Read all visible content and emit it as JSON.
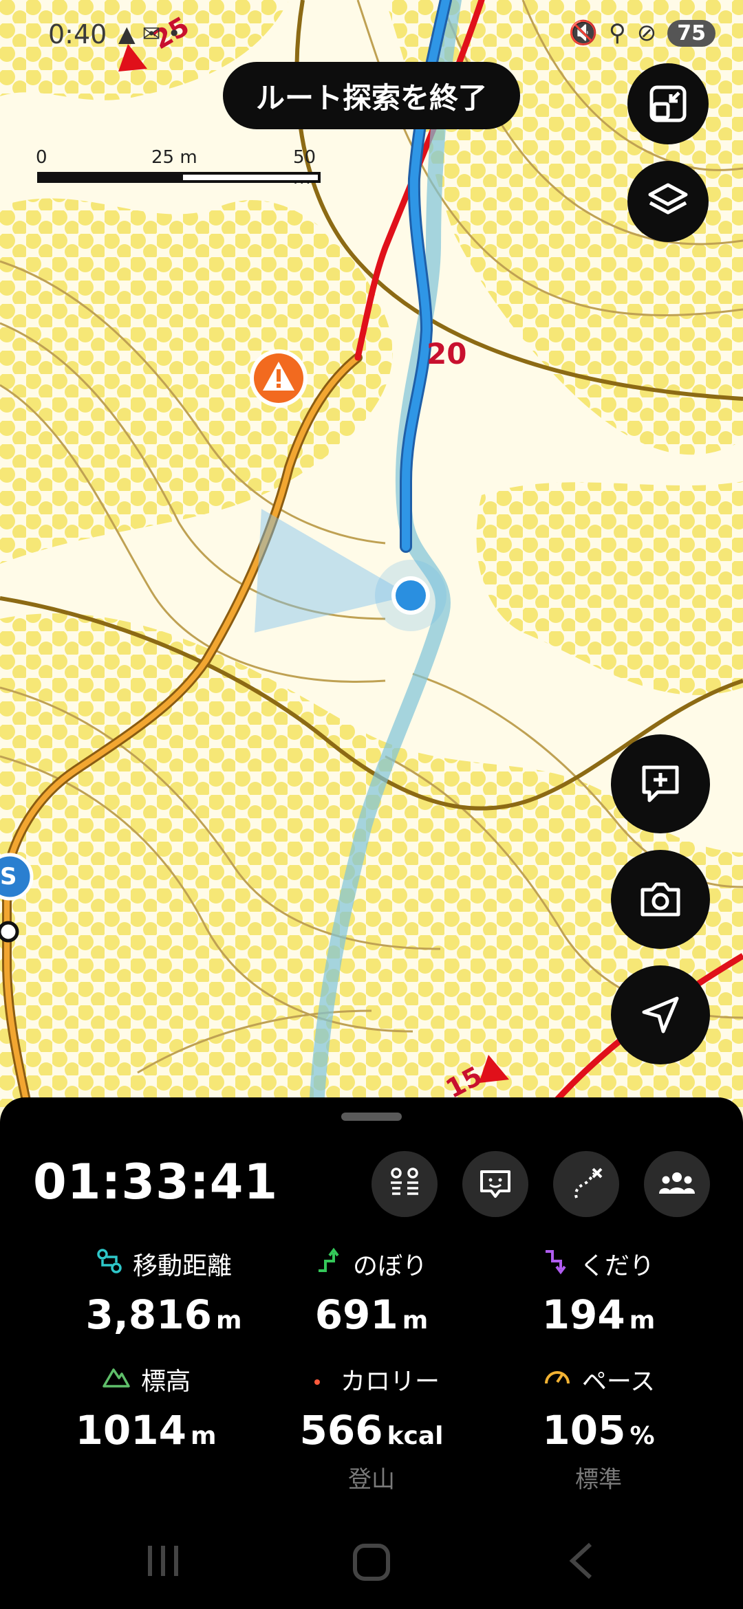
{
  "status_bar": {
    "time": "0:40",
    "notifications": "▲ ✉ •",
    "battery": "75"
  },
  "map": {
    "end_route_search": "ルート探索を終了",
    "scale": {
      "zero": "0",
      "mid": "25 m",
      "max": "50 m"
    },
    "contour_labels": {
      "a": "20",
      "b": "15",
      "c": "25"
    },
    "markers": {
      "start": "S"
    }
  },
  "panel": {
    "elapsed_time": "01:33:41",
    "stats": [
      {
        "label": "移動距離",
        "value": "3,816",
        "unit": "m",
        "sub": "",
        "icon": "route-icon",
        "color": "#2ec7c9"
      },
      {
        "label": "のぼり",
        "value": "691",
        "unit": "m",
        "sub": "",
        "icon": "ascent-icon",
        "color": "#34c759"
      },
      {
        "label": "くだり",
        "value": "194",
        "unit": "m",
        "sub": "",
        "icon": "descent-icon",
        "color": "#b05cf0"
      },
      {
        "label": "標高",
        "value": "1014",
        "unit": "m",
        "sub": "",
        "icon": "mountain-icon",
        "color": "#5fbf6a"
      },
      {
        "label": "カロリー",
        "value": "566",
        "unit": "kcal",
        "sub": "登山",
        "icon": "flame-icon",
        "color": "#ff5a3c"
      },
      {
        "label": "ペース",
        "value": "105",
        "unit": "%",
        "sub": "標準",
        "icon": "gauge-icon",
        "color": "#f2b233"
      }
    ]
  },
  "colors": {
    "accent_blue": "#2a8fe0",
    "route_red": "#e0101a",
    "trail_orange": "#f2a631",
    "contour": "#a8862a"
  }
}
